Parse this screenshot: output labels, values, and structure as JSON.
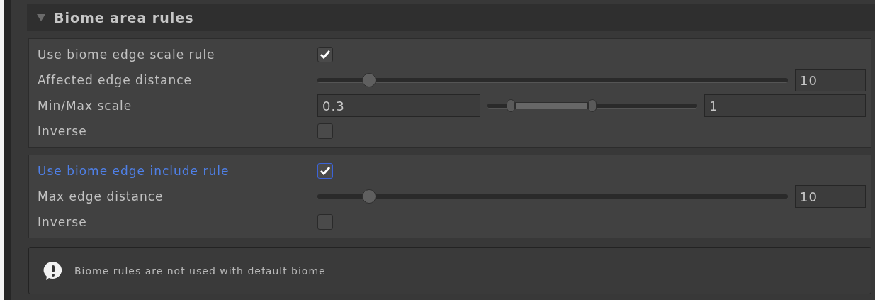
{
  "section": {
    "title": "Biome area rules",
    "expanded": true
  },
  "groups": [
    {
      "rows": [
        {
          "kind": "toggle",
          "label": "Use biome edge scale rule",
          "checked": true,
          "focused": false
        },
        {
          "kind": "slider",
          "label": "Affected edge distance",
          "level": 0.11,
          "value": "10"
        },
        {
          "kind": "minmax",
          "label": "Min/Max scale",
          "min": "0.3",
          "max": "1",
          "handles": [
            {
              "level": 0.11
            },
            {
              "level": 0.5
            }
          ]
        },
        {
          "kind": "toggle",
          "label": "Inverse",
          "checked": false,
          "focused": false
        }
      ]
    },
    {
      "rows": [
        {
          "kind": "toggle",
          "label": "Use biome edge include rule",
          "checked": true,
          "focused": true
        },
        {
          "kind": "slider",
          "label": "Max edge distance",
          "level": 0.11,
          "value": "10"
        },
        {
          "kind": "toggle",
          "label": "Inverse",
          "checked": false,
          "focused": false
        }
      ]
    }
  ],
  "help": {
    "message": "Biome rules are not used with default biome"
  }
}
